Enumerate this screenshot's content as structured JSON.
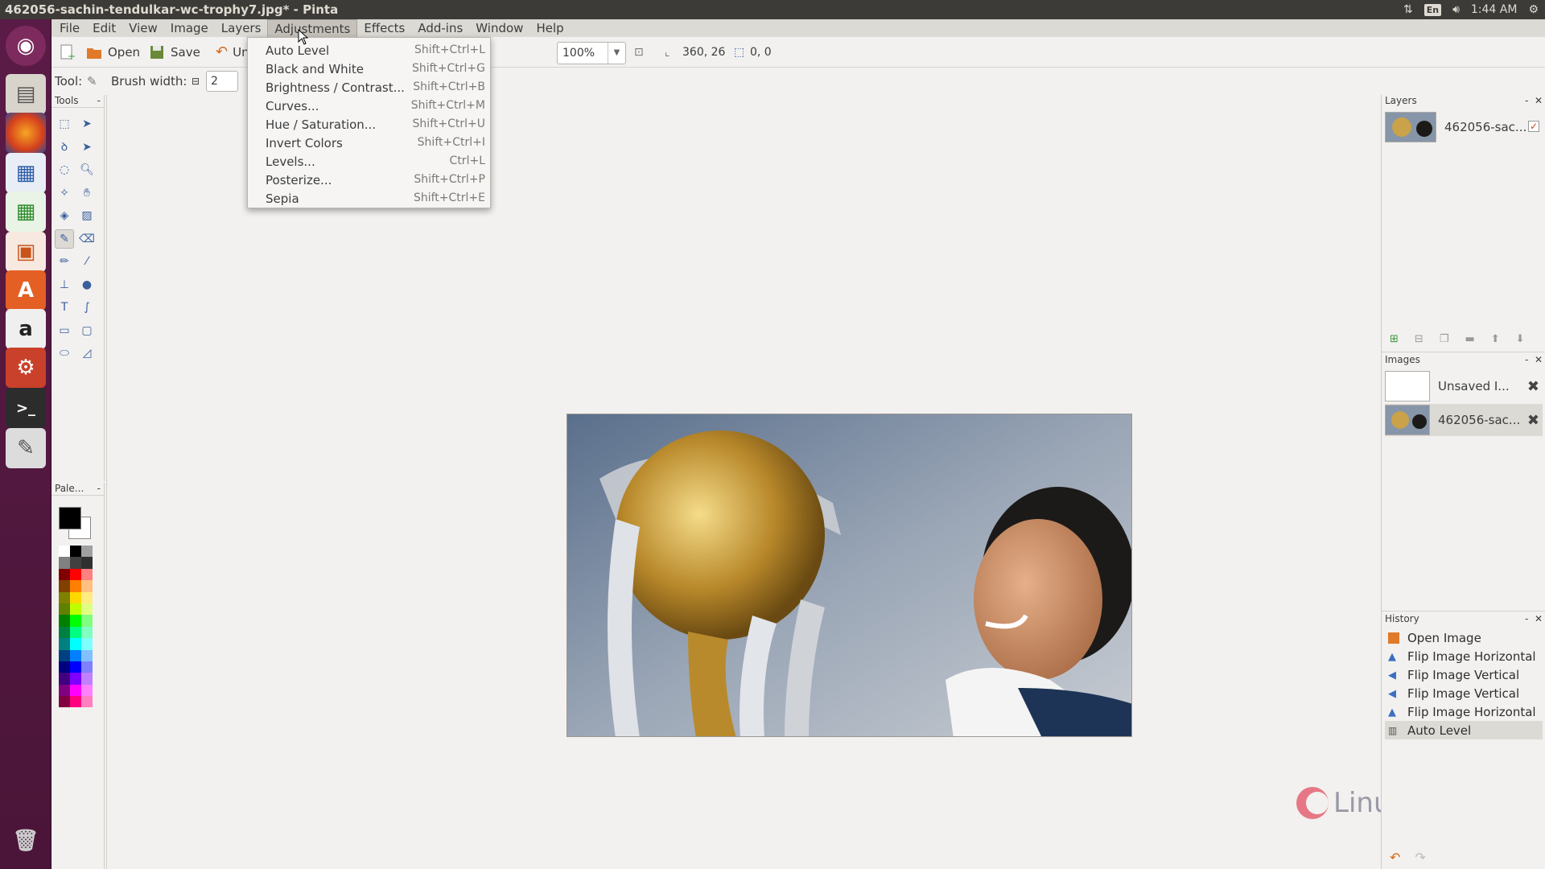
{
  "window": {
    "title": "462056-sachin-tendulkar-wc-trophy7.jpg* - Pinta"
  },
  "tray": {
    "keyboard": "En",
    "time": "1:44 AM"
  },
  "menubar": [
    "File",
    "Edit",
    "View",
    "Image",
    "Layers",
    "Adjustments",
    "Effects",
    "Add-ins",
    "Window",
    "Help"
  ],
  "toolbar": {
    "open_label": "Open",
    "save_label": "Save",
    "undo_label": "Un",
    "zoom": "100%",
    "cursor_pos": "360, 26",
    "selection_size": "0, 0"
  },
  "options": {
    "tool_label": "Tool:",
    "brush_width_label": "Brush width:",
    "brush_width": "2"
  },
  "panels": {
    "tools": "Tools",
    "palette": "Pale...",
    "layers": "Layers",
    "images": "Images",
    "history": "History"
  },
  "layers": [
    {
      "name": "462056-sac..."
    }
  ],
  "images": [
    {
      "name": "Unsaved I..."
    },
    {
      "name": "462056-sac..."
    }
  ],
  "history": [
    {
      "label": "Open Image",
      "icon": "open-image-icon"
    },
    {
      "label": "Flip Image Horizontal",
      "icon": "flip-horizontal-icon"
    },
    {
      "label": "Flip Image Vertical",
      "icon": "flip-vertical-icon"
    },
    {
      "label": "Flip Image Vertical",
      "icon": "flip-vertical-icon"
    },
    {
      "label": "Flip Image Horizontal",
      "icon": "flip-horizontal-icon"
    },
    {
      "label": "Auto Level",
      "icon": "auto-level-icon"
    }
  ],
  "adjustments_menu": [
    {
      "label": "Auto Level",
      "shortcut": "Shift+Ctrl+L"
    },
    {
      "label": "Black and White",
      "shortcut": "Shift+Ctrl+G"
    },
    {
      "label": "Brightness / Contrast...",
      "shortcut": "Shift+Ctrl+B"
    },
    {
      "label": "Curves...",
      "shortcut": "Shift+Ctrl+M"
    },
    {
      "label": "Hue / Saturation...",
      "shortcut": "Shift+Ctrl+U"
    },
    {
      "label": "Invert Colors",
      "shortcut": "Shift+Ctrl+I"
    },
    {
      "label": "Levels...",
      "shortcut": "Ctrl+L"
    },
    {
      "label": "Posterize...",
      "shortcut": "Shift+Ctrl+P"
    },
    {
      "label": "Sepia",
      "shortcut": "Shift+Ctrl+E"
    }
  ],
  "watermark": "LinuxHelp",
  "colors": {
    "launcher": "#5b1b47",
    "topbar": "#3c3b37",
    "menu_active": "#c6c2bb"
  }
}
